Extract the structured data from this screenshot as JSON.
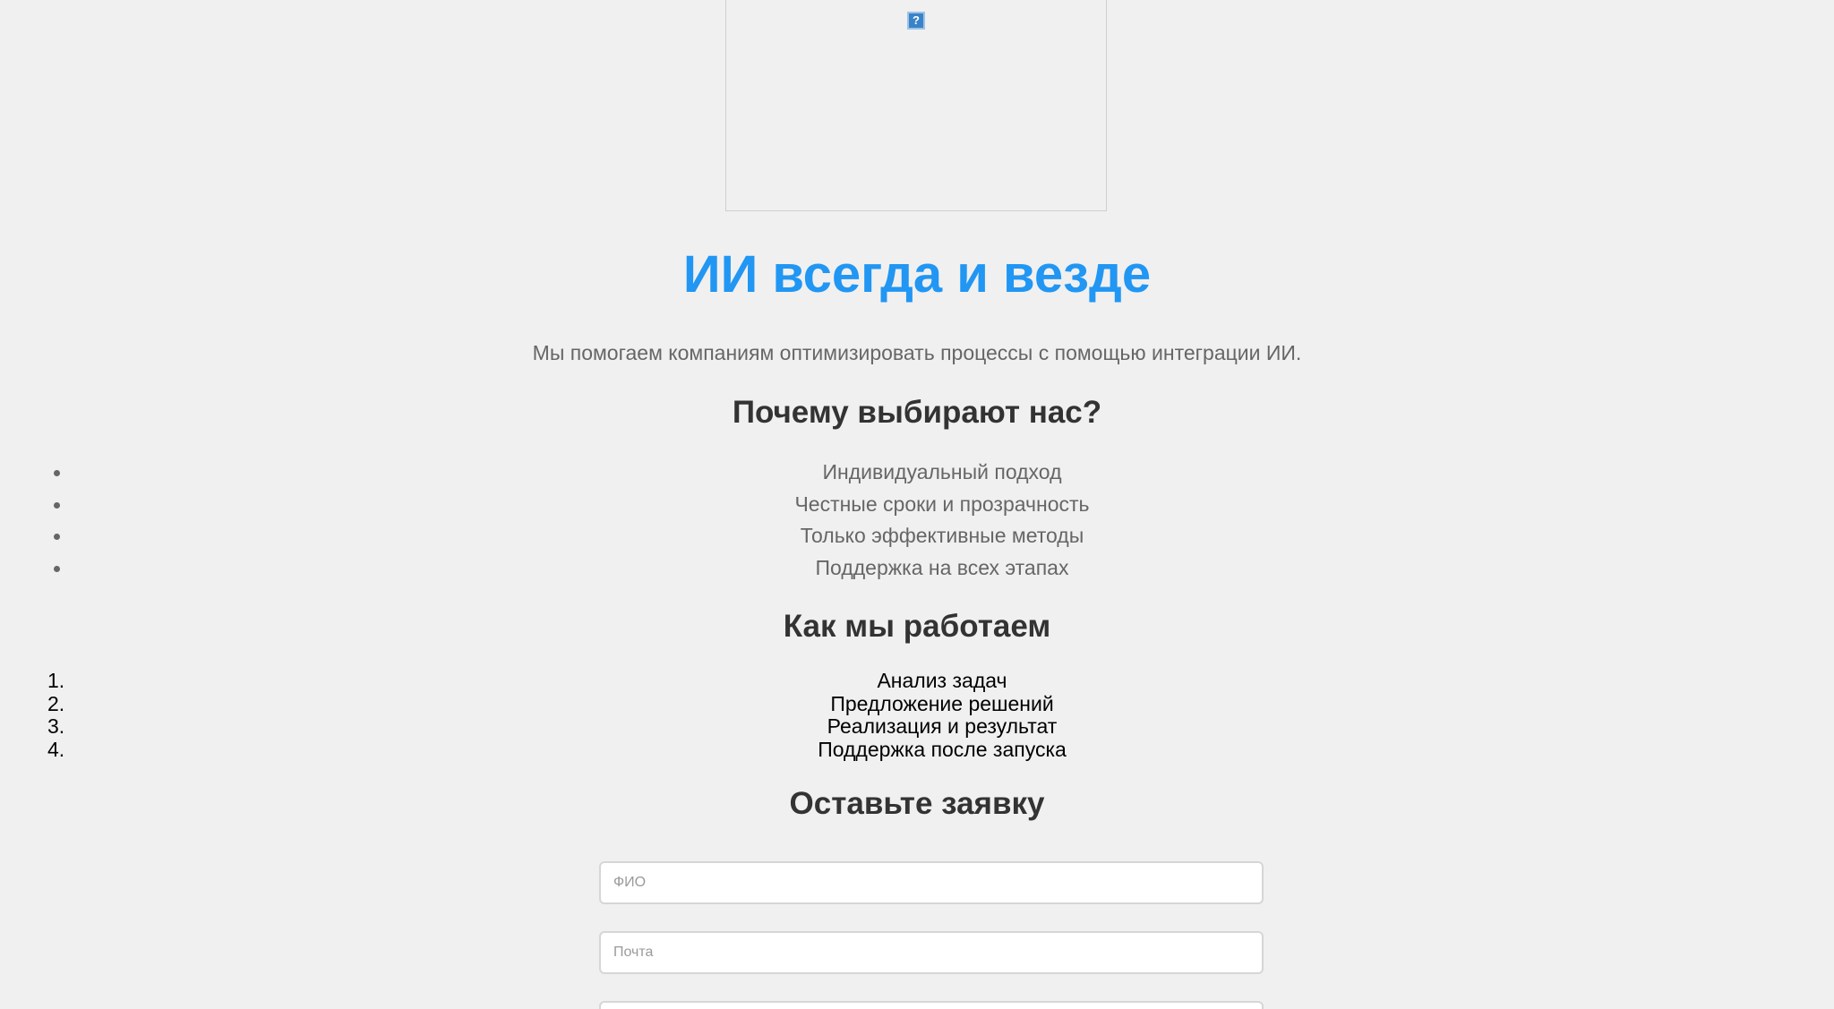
{
  "hero": {
    "image_icon": "broken-image-icon",
    "icon_glyph": "?"
  },
  "header": {
    "title": "ИИ всегда и везде",
    "subtitle": "Мы помогаем компаниям оптимизировать процессы с помощью интеграции ИИ.",
    "title_color": "#2196f3"
  },
  "why_us": {
    "heading": "Почему выбирают нас?",
    "items": [
      "Индивидуальный подход",
      "Честные сроки и прозрачность",
      "Только эффективные методы",
      "Поддержка на всех этапах"
    ]
  },
  "how_we_work": {
    "heading": "Как мы работаем",
    "markers": [
      "1.",
      "2.",
      "3.",
      "4."
    ],
    "steps": [
      "Анализ задач",
      "Предложение решений",
      "Реализация и результат",
      "Поддержка после запуска"
    ]
  },
  "form": {
    "heading": "Оставьте заявку",
    "name_placeholder": "ФИО",
    "email_placeholder": "Почта",
    "name_value": "",
    "email_value": ""
  }
}
